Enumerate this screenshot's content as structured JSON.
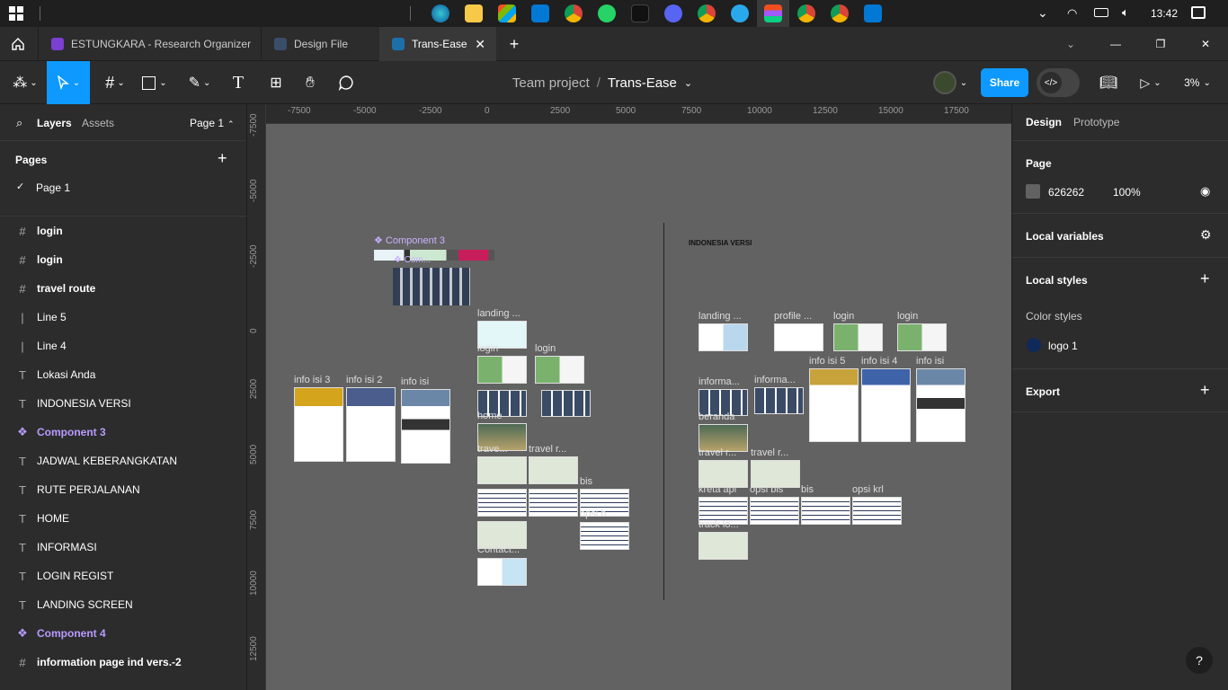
{
  "taskbar": {
    "time": "13:42"
  },
  "tabs": [
    {
      "label": "ESTUNGKARA - Research Organizer"
    },
    {
      "label": "Design File"
    },
    {
      "label": "Trans-Ease"
    }
  ],
  "toolbar": {
    "breadcrumb_project": "Team project",
    "breadcrumb_sep": "/",
    "file_name": "Trans-Ease",
    "share_label": "Share",
    "zoom": "3%"
  },
  "left": {
    "layers_tab": "Layers",
    "assets_tab": "Assets",
    "page_selector": "Page 1",
    "pages_heading": "Pages",
    "pages": [
      "Page 1"
    ],
    "layers": [
      {
        "icon": "#",
        "label": "login",
        "type": "frame"
      },
      {
        "icon": "#",
        "label": "login",
        "type": "frame"
      },
      {
        "icon": "#",
        "label": "travel route",
        "type": "frame"
      },
      {
        "icon": "|",
        "label": "Line 5",
        "type": "line"
      },
      {
        "icon": "|",
        "label": "Line 4",
        "type": "line"
      },
      {
        "icon": "T",
        "label": "Lokasi Anda",
        "type": "text"
      },
      {
        "icon": "T",
        "label": "INDONESIA VERSI",
        "type": "text"
      },
      {
        "icon": "❖",
        "label": "Component 3",
        "type": "component"
      },
      {
        "icon": "T",
        "label": "JADWAL KEBERANGKATAN",
        "type": "text"
      },
      {
        "icon": "T",
        "label": "RUTE PERJALANAN",
        "type": "text"
      },
      {
        "icon": "T",
        "label": "HOME",
        "type": "text"
      },
      {
        "icon": "T",
        "label": "INFORMASI",
        "type": "text"
      },
      {
        "icon": "T",
        "label": "LOGIN REGIST",
        "type": "text"
      },
      {
        "icon": "T",
        "label": "LANDING SCREEN",
        "type": "text"
      },
      {
        "icon": "❖",
        "label": "Component 4",
        "type": "component"
      },
      {
        "icon": "#",
        "label": "information page ind vers.-2",
        "type": "frame"
      }
    ]
  },
  "right": {
    "design_tab": "Design",
    "prototype_tab": "Prototype",
    "page_heading": "Page",
    "page_color": "626262",
    "page_opacity": "100%",
    "local_variables": "Local variables",
    "local_styles": "Local styles",
    "color_styles": "Color styles",
    "color_style_name": "logo 1",
    "export": "Export"
  },
  "rulers": {
    "top": [
      "-7500",
      "-5000",
      "-2500",
      "0",
      "2500",
      "5000",
      "7500",
      "10000",
      "12500",
      "15000",
      "17500"
    ],
    "left": [
      "-7500",
      "-5000",
      "-2500",
      "0",
      "2500",
      "5000",
      "7500",
      "10000",
      "12500"
    ]
  },
  "canvas": {
    "indonesia_label": "INDONESIA VERSI",
    "component3": "Component 3",
    "comp_small": "Com...",
    "labels": {
      "landing1": "landing ...",
      "login_a": "login",
      "login_b": "login",
      "info3": "info isi 3",
      "info2": "info isi 2",
      "info1": "info isi",
      "home": "home",
      "travel_a": "trave...",
      "travel_b": "travel r...",
      "bis": "bis",
      "opsi": "opsi b...",
      "contact": "Contact...",
      "landing2": "landing ...",
      "profile": "profile ...",
      "login_c": "login",
      "login_d": "login",
      "informa1": "informa...",
      "informa2": "informa...",
      "info5": "info isi 5",
      "info4": "info isi 4",
      "info_r": "info isi",
      "beranda": "beranda",
      "travel_c": "travel r...",
      "travel_d": "travel r...",
      "kreta": "kreta api",
      "opsibis": "opsi bis",
      "bis2": "bis",
      "opsikrl": "opsi krl",
      "trackl": "track lo..."
    }
  },
  "colors": {
    "accent": "#0d99ff",
    "component": "#b89bff",
    "canvas": "#626262"
  }
}
